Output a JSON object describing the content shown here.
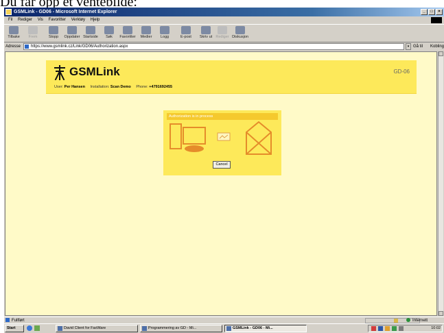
{
  "caption": "Du får opp et ventebilde:",
  "window": {
    "title": "GSMLink - GD06 - Microsoft Internet Explorer",
    "buttons": [
      "_",
      "□",
      "×"
    ]
  },
  "menu": [
    "Fil",
    "Rediger",
    "Vis",
    "Favoritter",
    "Verktøy",
    "Hjelp"
  ],
  "toolbar": [
    {
      "label": "Tilbake",
      "icon": "back-arrow-icon"
    },
    {
      "label": "Frem",
      "icon": "forward-arrow-icon",
      "disabled": true
    },
    {
      "label": "Stopp",
      "icon": "stop-icon"
    },
    {
      "label": "Oppdater",
      "icon": "refresh-icon"
    },
    {
      "label": "Startside",
      "icon": "home-icon"
    },
    {
      "label": "Søk",
      "icon": "search-icon"
    },
    {
      "label": "Favoritter",
      "icon": "favorites-icon"
    },
    {
      "label": "Medier",
      "icon": "media-icon"
    },
    {
      "label": "Logg",
      "icon": "history-icon"
    },
    {
      "label": "E-post",
      "icon": "mail-icon"
    },
    {
      "label": "Skriv ut",
      "icon": "print-icon"
    },
    {
      "label": "Rediger",
      "icon": "edit-icon",
      "disabled": true
    },
    {
      "label": "Diskusjon",
      "icon": "discuss-icon"
    }
  ],
  "address": {
    "label": "Adresse",
    "url": "https://www.gsmlink.cz/Link/GD06/Authorization.aspx",
    "go_label": "Gå til",
    "links_label": "Koblinger »"
  },
  "page": {
    "brand": "GSMLink",
    "device_code": "GD-06",
    "user_label": "User:",
    "user_value": "Per Hansen",
    "installation_label": "Installation:",
    "installation_value": "Scan Demo",
    "phone_label": "Phone:",
    "phone_value": "+4791692455"
  },
  "dialog": {
    "title": "Authorization is in process",
    "cancel_label": "Cancel"
  },
  "status": {
    "text": "Fullført",
    "zone": "Internett"
  },
  "taskbar": {
    "start_label": "Start",
    "tasks": [
      {
        "label": "David Client for FaxWare",
        "active": false
      },
      {
        "label": "Programmering av GD - Mi...",
        "active": false
      },
      {
        "label": "GSMLink - GD06 - Mi...",
        "active": true
      }
    ],
    "clock": "10:02"
  },
  "colors": {
    "page_bg": "#fffac8",
    "header_bg": "#fde95a",
    "dialog_title_bg": "#f5c92e",
    "illustration_stroke": "#e58c2a",
    "titlebar": "#0a246a"
  }
}
